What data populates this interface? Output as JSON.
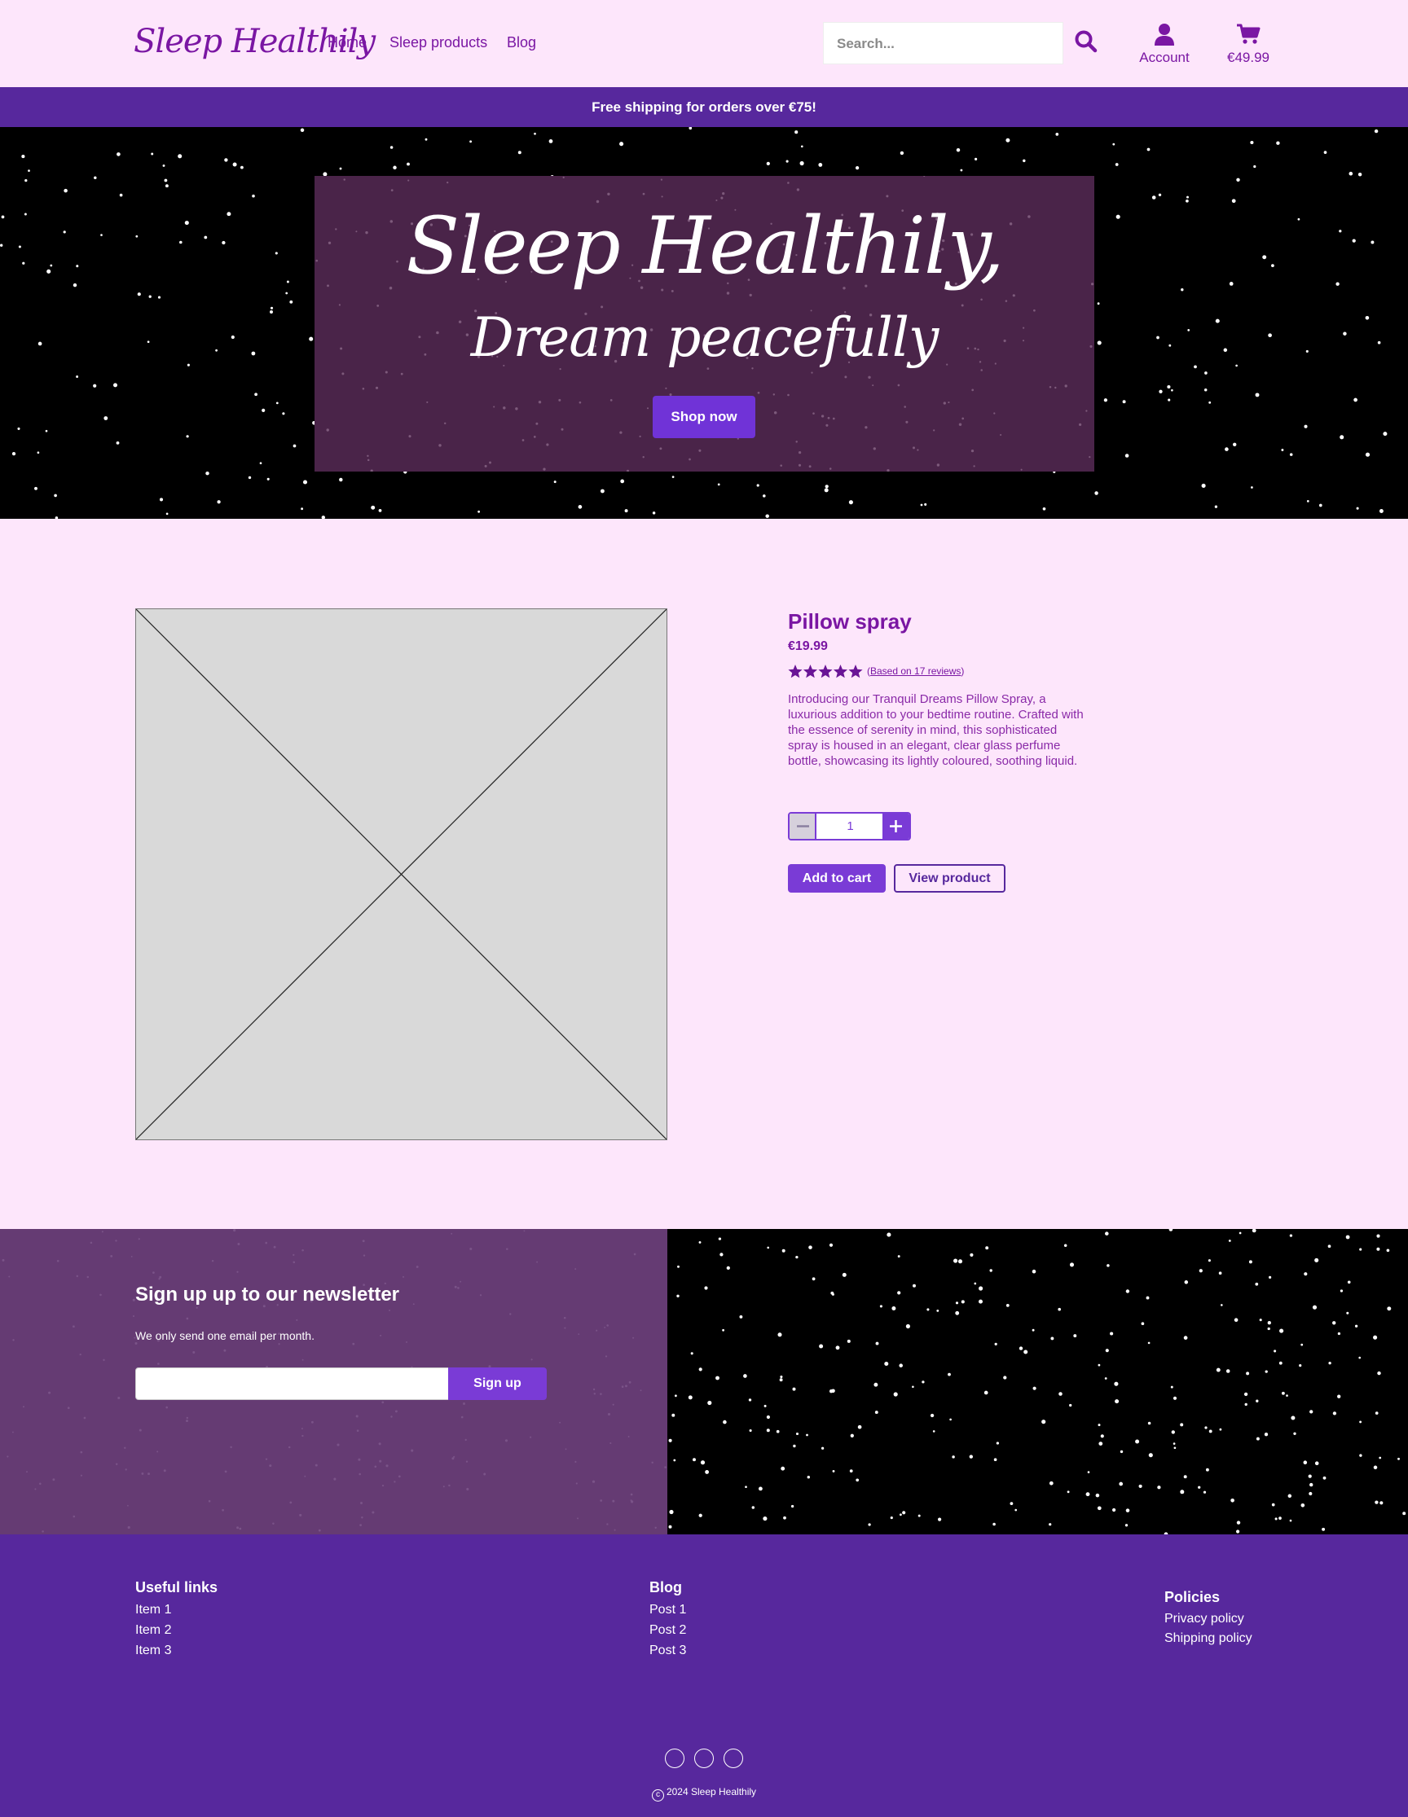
{
  "header": {
    "logo": "Sleep Healthily",
    "nav": [
      "Home",
      "Sleep products",
      "Blog"
    ],
    "search_placeholder": "Search...",
    "account_label": "Account",
    "cart_total": "€49.99"
  },
  "banner": {
    "text": "Free shipping for orders over €75!"
  },
  "hero": {
    "title_line1": "Sleep Healthily,",
    "title_line2": "Dream peacefully",
    "cta_label": "Shop now"
  },
  "product": {
    "title": "Pillow spray",
    "price": "€19.99",
    "rating": 5,
    "rating_max": 5,
    "reviews_text": "Based on 17 reviews",
    "description": "Introducing our Tranquil Dreams Pillow Spray, a luxurious addition to your bedtime routine. Crafted with the essence of serenity in mind, this sophisticated spray is housed in an elegant, clear glass perfume bottle, showcasing its lightly coloured, soothing liquid.",
    "quantity": "1",
    "add_to_cart_label": "Add to cart",
    "view_product_label": "View product"
  },
  "newsletter": {
    "title": "Sign up up to our newsletter",
    "subtitle": "We only send one email per month.",
    "button_label": "Sign up"
  },
  "footer": {
    "columns": [
      {
        "heading": "Useful links",
        "items": [
          "Item 1",
          "Item 2",
          "Item 3"
        ]
      },
      {
        "heading": "Blog",
        "items": [
          "Post 1",
          "Post 2",
          "Post 3"
        ]
      },
      {
        "heading": "Policies",
        "items": [
          "Privacy policy",
          "Shipping policy"
        ]
      }
    ],
    "copyright": "2024 Sleep Healthily"
  },
  "colors": {
    "background": "#fde6fb",
    "text_purple": "#7a16a3",
    "banner_purple": "#57289d",
    "button_purple": "#7a3bd6",
    "hero_box": "#4a2449",
    "newsletter_panel": "#653b73"
  }
}
